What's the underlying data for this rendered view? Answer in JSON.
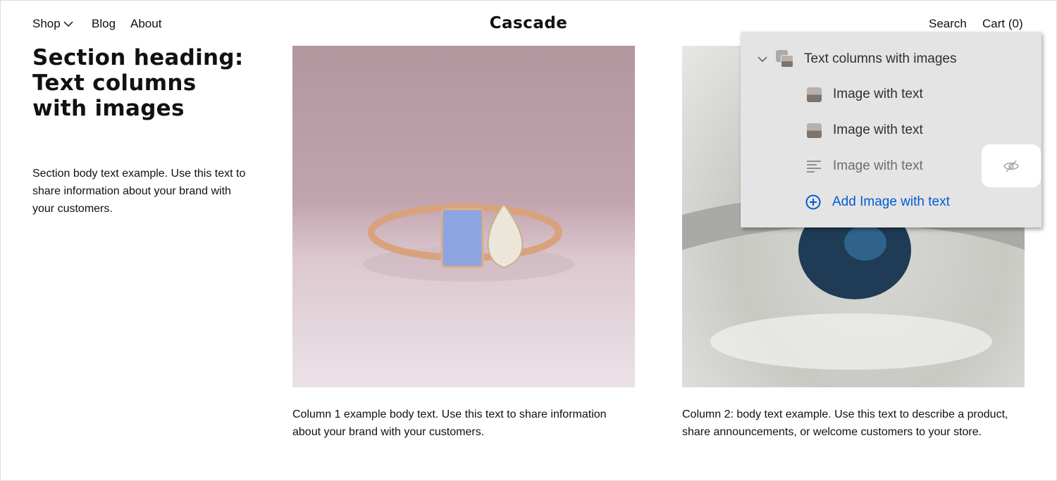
{
  "header": {
    "nav": [
      "Shop",
      "Blog",
      "About"
    ],
    "logo": "Cascade",
    "search": "Search",
    "cart": "Cart (0)"
  },
  "section": {
    "heading": "Section heading: Text columns with images",
    "body": "Section body text example. Use this text to share information about your brand with your customers."
  },
  "columns": [
    {
      "caption": "Column 1 example body text. Use this text to share information about your brand with your customers."
    },
    {
      "caption": "Column 2: body text example. Use this text to describe a product, share announcements, or welcome customers to your store."
    }
  ],
  "panel": {
    "parent": "Text columns with images",
    "items": [
      {
        "label": "Image with text",
        "icon": "image-thumbnail-icon",
        "hidden": false
      },
      {
        "label": "Image with text",
        "icon": "image-thumbnail-icon",
        "hidden": false
      },
      {
        "label": "Image with text",
        "icon": "text-lines-icon",
        "hidden": true
      }
    ],
    "add_label": "Add Image with text",
    "accent": "#005bd3"
  }
}
